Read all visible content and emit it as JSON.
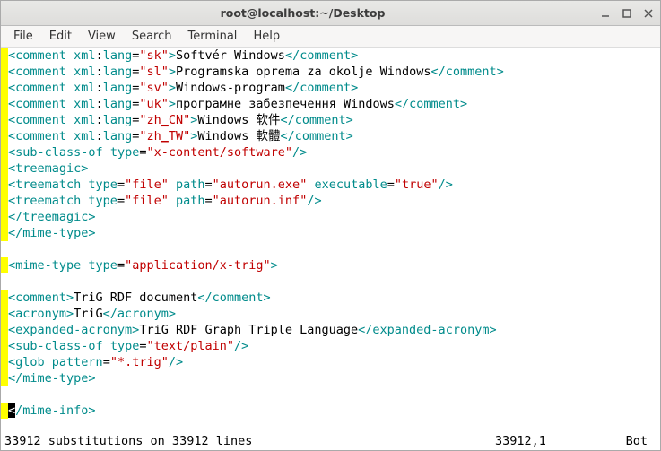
{
  "window": {
    "title": "root@localhost:~/Desktop"
  },
  "menu": {
    "items": [
      "File",
      "Edit",
      "View",
      "Search",
      "Terminal",
      "Help"
    ]
  },
  "syntax_colors": {
    "tag": "#008b8b",
    "string": "#c00000",
    "text": "#000000",
    "gutter_highlight": "#ffff00"
  },
  "lines": [
    {
      "hl": true,
      "tokens": [
        {
          "c": "tagb",
          "t": "<comment"
        },
        {
          "c": "txt",
          "t": " "
        },
        {
          "c": "attr",
          "t": "xml"
        },
        {
          "c": "txt",
          "t": ":"
        },
        {
          "c": "attr",
          "t": "lang"
        },
        {
          "c": "txt",
          "t": "="
        },
        {
          "c": "str",
          "t": "\"sk\""
        },
        {
          "c": "tagb",
          "t": ">"
        },
        {
          "c": "txt",
          "t": "Softvér Windows"
        },
        {
          "c": "tagb",
          "t": "</comment>"
        }
      ]
    },
    {
      "hl": true,
      "tokens": [
        {
          "c": "tagb",
          "t": "<comment"
        },
        {
          "c": "txt",
          "t": " "
        },
        {
          "c": "attr",
          "t": "xml"
        },
        {
          "c": "txt",
          "t": ":"
        },
        {
          "c": "attr",
          "t": "lang"
        },
        {
          "c": "txt",
          "t": "="
        },
        {
          "c": "str",
          "t": "\"sl\""
        },
        {
          "c": "tagb",
          "t": ">"
        },
        {
          "c": "txt",
          "t": "Programska oprema za okolje Windows"
        },
        {
          "c": "tagb",
          "t": "</comment>"
        }
      ]
    },
    {
      "hl": true,
      "tokens": [
        {
          "c": "tagb",
          "t": "<comment"
        },
        {
          "c": "txt",
          "t": " "
        },
        {
          "c": "attr",
          "t": "xml"
        },
        {
          "c": "txt",
          "t": ":"
        },
        {
          "c": "attr",
          "t": "lang"
        },
        {
          "c": "txt",
          "t": "="
        },
        {
          "c": "str",
          "t": "\"sv\""
        },
        {
          "c": "tagb",
          "t": ">"
        },
        {
          "c": "txt",
          "t": "Windows-program"
        },
        {
          "c": "tagb",
          "t": "</comment>"
        }
      ]
    },
    {
      "hl": true,
      "tokens": [
        {
          "c": "tagb",
          "t": "<comment"
        },
        {
          "c": "txt",
          "t": " "
        },
        {
          "c": "attr",
          "t": "xml"
        },
        {
          "c": "txt",
          "t": ":"
        },
        {
          "c": "attr",
          "t": "lang"
        },
        {
          "c": "txt",
          "t": "="
        },
        {
          "c": "str",
          "t": "\"uk\""
        },
        {
          "c": "tagb",
          "t": ">"
        },
        {
          "c": "txt",
          "t": "програмне забезпечення Windows"
        },
        {
          "c": "tagb",
          "t": "</comment>"
        }
      ]
    },
    {
      "hl": true,
      "tokens": [
        {
          "c": "tagb",
          "t": "<comment"
        },
        {
          "c": "txt",
          "t": " "
        },
        {
          "c": "attr",
          "t": "xml"
        },
        {
          "c": "txt",
          "t": ":"
        },
        {
          "c": "attr",
          "t": "lang"
        },
        {
          "c": "txt",
          "t": "="
        },
        {
          "c": "str",
          "t": "\"zh"
        },
        {
          "c": "str under",
          "t": "_"
        },
        {
          "c": "str",
          "t": "CN\""
        },
        {
          "c": "tagb",
          "t": ">"
        },
        {
          "c": "txt",
          "t": "Windows 软件"
        },
        {
          "c": "tagb",
          "t": "</comment>"
        }
      ]
    },
    {
      "hl": true,
      "tokens": [
        {
          "c": "tagb",
          "t": "<comment"
        },
        {
          "c": "txt",
          "t": " "
        },
        {
          "c": "attr",
          "t": "xml"
        },
        {
          "c": "txt",
          "t": ":"
        },
        {
          "c": "attr",
          "t": "lang"
        },
        {
          "c": "txt",
          "t": "="
        },
        {
          "c": "str",
          "t": "\"zh"
        },
        {
          "c": "str under",
          "t": "_"
        },
        {
          "c": "str",
          "t": "TW\""
        },
        {
          "c": "tagb",
          "t": ">"
        },
        {
          "c": "txt",
          "t": "Windows 軟體"
        },
        {
          "c": "tagb",
          "t": "</comment>"
        }
      ]
    },
    {
      "hl": true,
      "tokens": [
        {
          "c": "tagb",
          "t": "<sub-class-of"
        },
        {
          "c": "txt",
          "t": " "
        },
        {
          "c": "attr",
          "t": "type"
        },
        {
          "c": "txt",
          "t": "="
        },
        {
          "c": "str",
          "t": "\"x-content/software\""
        },
        {
          "c": "tagb",
          "t": "/>"
        }
      ]
    },
    {
      "hl": true,
      "tokens": [
        {
          "c": "tagb",
          "t": "<treemagic>"
        }
      ]
    },
    {
      "hl": true,
      "tokens": [
        {
          "c": "tagb",
          "t": "<treematch"
        },
        {
          "c": "txt",
          "t": " "
        },
        {
          "c": "attr",
          "t": "type"
        },
        {
          "c": "txt",
          "t": "="
        },
        {
          "c": "str",
          "t": "\"file\""
        },
        {
          "c": "txt",
          "t": " "
        },
        {
          "c": "attr",
          "t": "path"
        },
        {
          "c": "txt",
          "t": "="
        },
        {
          "c": "str",
          "t": "\"autorun.exe\""
        },
        {
          "c": "txt",
          "t": " "
        },
        {
          "c": "attr",
          "t": "executable"
        },
        {
          "c": "txt",
          "t": "="
        },
        {
          "c": "str",
          "t": "\"true\""
        },
        {
          "c": "tagb",
          "t": "/>"
        }
      ]
    },
    {
      "hl": true,
      "tokens": [
        {
          "c": "tagb",
          "t": "<treematch"
        },
        {
          "c": "txt",
          "t": " "
        },
        {
          "c": "attr",
          "t": "type"
        },
        {
          "c": "txt",
          "t": "="
        },
        {
          "c": "str",
          "t": "\"file\""
        },
        {
          "c": "txt",
          "t": " "
        },
        {
          "c": "attr",
          "t": "path"
        },
        {
          "c": "txt",
          "t": "="
        },
        {
          "c": "str",
          "t": "\"autorun.inf\""
        },
        {
          "c": "tagb",
          "t": "/>"
        }
      ]
    },
    {
      "hl": true,
      "tokens": [
        {
          "c": "tagb",
          "t": "</treemagic>"
        }
      ]
    },
    {
      "hl": true,
      "tokens": [
        {
          "c": "tagb",
          "t": "</mime-type>"
        }
      ]
    },
    {
      "hl": false,
      "tokens": [
        {
          "c": "txt",
          "t": " "
        }
      ]
    },
    {
      "hl": true,
      "tokens": [
        {
          "c": "tagb",
          "t": "<mime-type"
        },
        {
          "c": "txt",
          "t": " "
        },
        {
          "c": "attr",
          "t": "type"
        },
        {
          "c": "txt",
          "t": "="
        },
        {
          "c": "str",
          "t": "\"application/x-trig\""
        },
        {
          "c": "tagb",
          "t": ">"
        }
      ]
    },
    {
      "hl": false,
      "tokens": [
        {
          "c": "txt",
          "t": " "
        }
      ]
    },
    {
      "hl": true,
      "tokens": [
        {
          "c": "tagb",
          "t": "<comment>"
        },
        {
          "c": "txt",
          "t": "TriG RDF document"
        },
        {
          "c": "tagb",
          "t": "</comment>"
        }
      ]
    },
    {
      "hl": true,
      "tokens": [
        {
          "c": "tagb",
          "t": "<acronym>"
        },
        {
          "c": "txt",
          "t": "TriG"
        },
        {
          "c": "tagb",
          "t": "</acronym>"
        }
      ]
    },
    {
      "hl": true,
      "tokens": [
        {
          "c": "tagb",
          "t": "<expanded-acronym>"
        },
        {
          "c": "txt",
          "t": "TriG RDF Graph Triple Language"
        },
        {
          "c": "tagb",
          "t": "</expanded-acronym>"
        }
      ]
    },
    {
      "hl": true,
      "tokens": [
        {
          "c": "tagb",
          "t": "<sub-class-of"
        },
        {
          "c": "txt",
          "t": " "
        },
        {
          "c": "attr",
          "t": "type"
        },
        {
          "c": "txt",
          "t": "="
        },
        {
          "c": "str",
          "t": "\"text/plain\""
        },
        {
          "c": "tagb",
          "t": "/>"
        }
      ]
    },
    {
      "hl": true,
      "tokens": [
        {
          "c": "tagb",
          "t": "<glob"
        },
        {
          "c": "txt",
          "t": " "
        },
        {
          "c": "attr",
          "t": "pattern"
        },
        {
          "c": "txt",
          "t": "="
        },
        {
          "c": "str",
          "t": "\"*.trig\""
        },
        {
          "c": "tagb",
          "t": "/>"
        }
      ]
    },
    {
      "hl": true,
      "tokens": [
        {
          "c": "tagb",
          "t": "</mime-type>"
        }
      ]
    },
    {
      "hl": false,
      "tokens": [
        {
          "c": "txt",
          "t": " "
        }
      ]
    },
    {
      "hl": true,
      "cursor": true,
      "tokens": [
        {
          "c": "tagb",
          "t": "</mime-info>"
        }
      ]
    }
  ],
  "status": {
    "left": "33912 substitutions on 33912 lines",
    "position": "33912,1",
    "scroll": "Bot"
  }
}
